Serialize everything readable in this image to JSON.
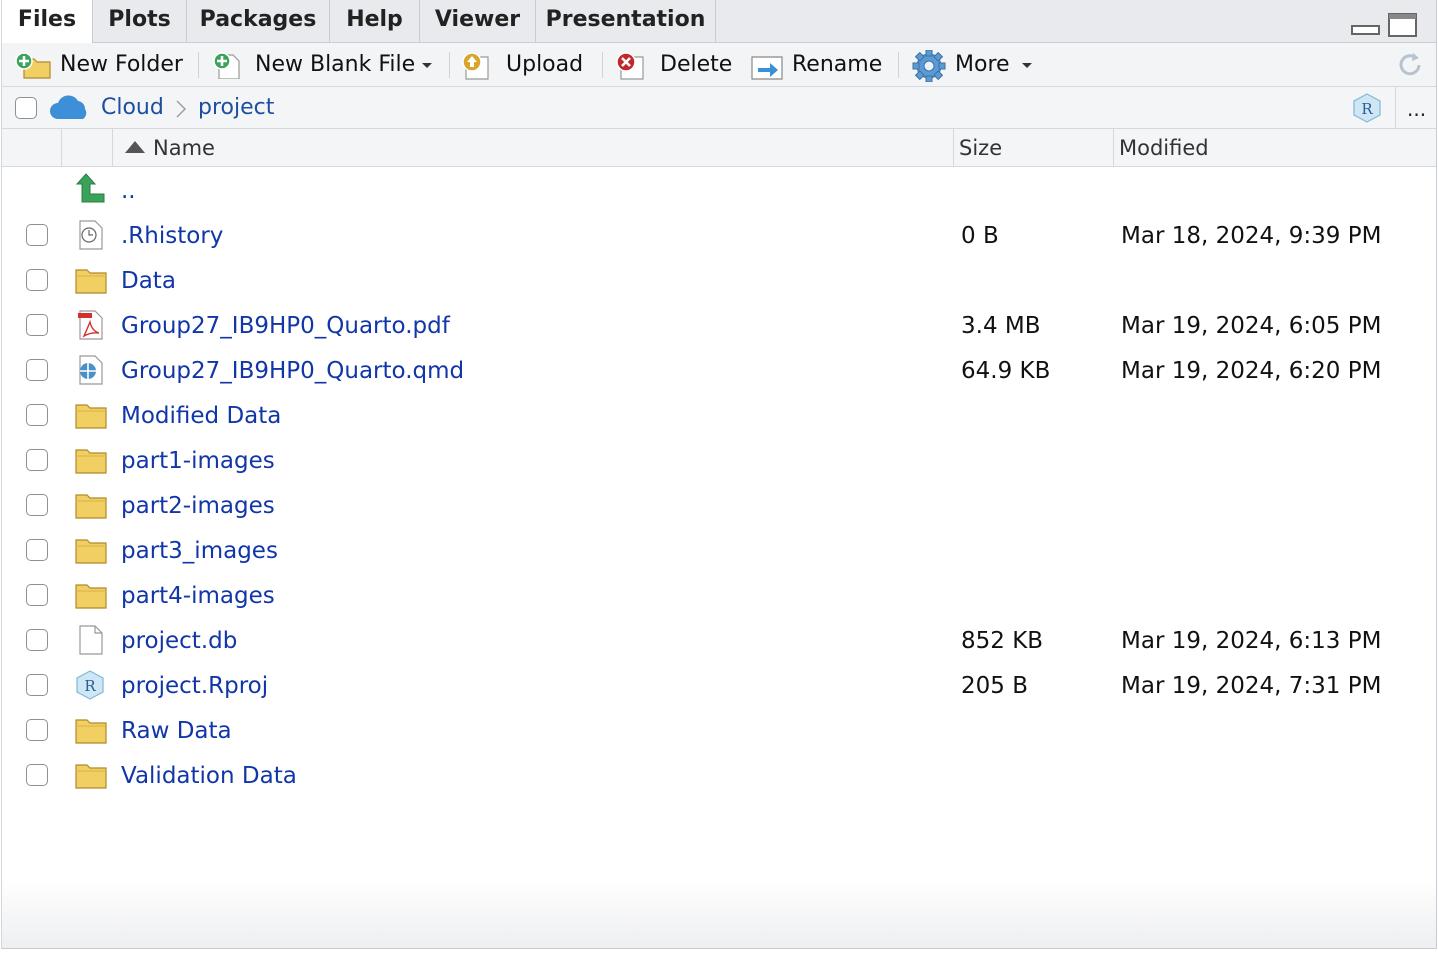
{
  "tabs": [
    {
      "label": "Files",
      "active": true
    },
    {
      "label": "Plots",
      "active": false
    },
    {
      "label": "Packages",
      "active": false
    },
    {
      "label": "Help",
      "active": false
    },
    {
      "label": "Viewer",
      "active": false
    },
    {
      "label": "Presentation",
      "active": false
    }
  ],
  "toolbar": {
    "new_folder": "New Folder",
    "new_blank_file": "New Blank File",
    "upload": "Upload",
    "delete": "Delete",
    "rename": "Rename",
    "more": "More"
  },
  "breadcrumb": {
    "root": "Cloud",
    "current": "project",
    "overflow": "..."
  },
  "columns": {
    "name": "Name",
    "size": "Size",
    "modified": "Modified",
    "sort": "ascending"
  },
  "parent_row": {
    "label": ".."
  },
  "files": [
    {
      "name": ".Rhistory",
      "type": "history",
      "size": "0 B",
      "modified": "Mar 18, 2024, 9:39 PM"
    },
    {
      "name": "Data",
      "type": "folder",
      "size": "",
      "modified": ""
    },
    {
      "name": "Group27_IB9HP0_Quarto.pdf",
      "type": "pdf",
      "size": "3.4 MB",
      "modified": "Mar 19, 2024, 6:05 PM"
    },
    {
      "name": "Group27_IB9HP0_Quarto.qmd",
      "type": "quarto",
      "size": "64.9 KB",
      "modified": "Mar 19, 2024, 6:20 PM"
    },
    {
      "name": "Modified Data",
      "type": "folder",
      "size": "",
      "modified": ""
    },
    {
      "name": "part1-images",
      "type": "folder",
      "size": "",
      "modified": ""
    },
    {
      "name": "part2-images",
      "type": "folder",
      "size": "",
      "modified": ""
    },
    {
      "name": "part3_images",
      "type": "folder",
      "size": "",
      "modified": ""
    },
    {
      "name": "part4-images",
      "type": "folder",
      "size": "",
      "modified": ""
    },
    {
      "name": "project.db",
      "type": "blank",
      "size": "852 KB",
      "modified": "Mar 19, 2024, 6:13 PM"
    },
    {
      "name": "project.Rproj",
      "type": "rproj",
      "size": "205 B",
      "modified": "Mar 19, 2024, 7:31 PM"
    },
    {
      "name": "Raw Data",
      "type": "folder",
      "size": "",
      "modified": ""
    },
    {
      "name": "Validation Data",
      "type": "folder",
      "size": "",
      "modified": ""
    }
  ],
  "colors": {
    "link": "#1136a8",
    "crumb": "#1c4fa0",
    "folder": "#f2cf63",
    "up_arrow": "#3aa35a"
  }
}
